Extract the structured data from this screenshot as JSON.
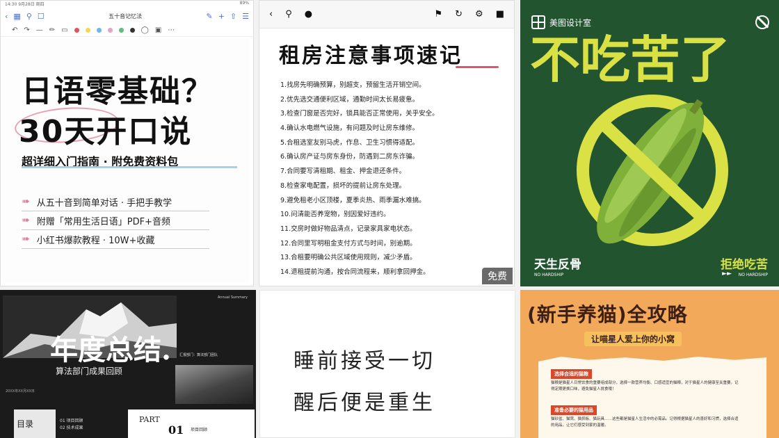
{
  "card1": {
    "status_left": "14:30  9月28日 周四",
    "status_right": "89%",
    "doc_title": "五十音记忆法",
    "title_line1": "日语零基础？",
    "title_line2": "30天开口说",
    "subtitle": "超详细入门指南 · 附免费资料包",
    "items": [
      "从五十音到简单对话 · 手把手教学",
      "附赠「常用生活日语」PDF+音频",
      "小红书爆款教程 · 10W+收藏"
    ],
    "colors": [
      "#e94f5a",
      "#f6d84a",
      "#6ab7f0",
      "#e6a3c2",
      "#5ac07a",
      "#333333"
    ]
  },
  "card2": {
    "title": "租房注意事项速记",
    "items": [
      "1.找房先明确预算，别超支，预留生活开销空间。",
      "2.优先选交通便利区域，通勤时间太长易疲惫。",
      "3.检查门窗是否完好，锁具能否正常使用，关乎安全。",
      "4.确认水电燃气设施，有问题及时让房东维修。",
      "5.合租选室友别马虎，作息、卫生习惯得适配。",
      "6.确认房产证与房东身份，防遇到二房东诈骗。",
      "7.合同要写清租期、租金、押金退还条件。",
      "8.检查家电配置，损坏的提前让房东处理。",
      "9.避免租老小区顶楼，夏季炎热、雨季漏水难搞。",
      "10.问清能否养宠物，别因爱好违约。",
      "11.交房时做好物品清点，记录家具家电状态。",
      "12.合同里写明租金支付方式与时间，别逾期。",
      "13.合租要明确公共区域使用规则，减少矛盾。",
      "14.退租提前沟通，按合同流程来，顺利拿回押金。"
    ],
    "badge": "免费"
  },
  "card3": {
    "brand": "美图设计室",
    "title": "不吃苦了",
    "left_caption": "天生反骨",
    "right_caption": "拒绝吃苦",
    "foot_left": "NO HARDSHIP",
    "foot_right": "NO HARDSHIP",
    "foot_arrows": "►►",
    "accent": "#d9e144",
    "bg": "#21542f"
  },
  "card4": {
    "tag": "Annual Summary",
    "title": "年度总结.",
    "subtitle": "算法部门成果回顾",
    "small_text": "汇报部门：算法部门团队",
    "date_text": "20XX年XX月XX日",
    "toc_label": "目录",
    "toc_items": [
      "01 项目回顾",
      "02 技术成果"
    ],
    "part_label": "PART",
    "part_num": "01",
    "part_item": "项目回顾"
  },
  "card5": {
    "line1": "睡前接受一切",
    "line2": "醒后便是重生"
  },
  "card6": {
    "title": "(新手养猫)全攻略",
    "badge": "让喵星人爱上你的小窝",
    "sections": [
      {
        "tag": "选择合适的猫粮",
        "body": "猫粮是猫星人日常饮食的重要组成部分，选择一款营养均衡、口感适宜的猫粮，对于猫星人的健康至关重要。记得定期更换口味，避免猫星人挑食哦！"
      },
      {
        "tag": "准备必要的猫用品",
        "body": "猫砂盆、猫窝、猫抓板、猫玩具……这些都是猫星人生活中的必需品。记得根据猫星人的喜好和习惯，选择合适的用品，让它们感受到家的温暖。"
      }
    ]
  }
}
